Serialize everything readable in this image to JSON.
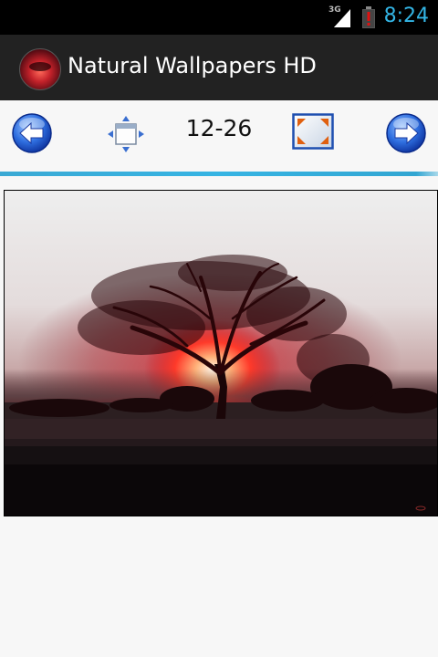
{
  "status_bar": {
    "network": "3G",
    "time": "8:24",
    "colors": {
      "accent": "#33b5e5",
      "battery_alert": "#cc0000"
    },
    "icons": [
      "signal-icon",
      "battery-alert-icon"
    ]
  },
  "action_bar": {
    "title": "Natural Wallpapers HD",
    "icon": "app-icon"
  },
  "toolbar": {
    "counter": "12-26",
    "icons": [
      "prev-arrow-icon",
      "resize-icon",
      "fullscreen-icon",
      "next-arrow-icon"
    ]
  },
  "wallpaper": {
    "subject": "tree-sunset-image",
    "colors": {
      "sky": "#e8e4e4",
      "glow": "#ff3a2a",
      "ground": "#1a1012"
    }
  }
}
